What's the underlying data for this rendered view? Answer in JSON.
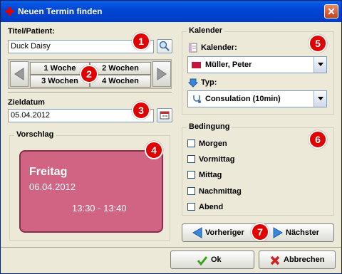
{
  "window": {
    "title": "Neuen Termin finden",
    "close_glyph": "✕"
  },
  "patient": {
    "label": "Titel/Patient:",
    "value": "Duck Daisy"
  },
  "nav": {
    "btn_1w_fwd": "1 Woche",
    "btn_2w_fwd": "2 Wochen",
    "btn_3w": "3 Wochen",
    "btn_4w": "4 Wochen"
  },
  "target": {
    "label": "Zieldatum",
    "value": "05.04.2012"
  },
  "proposal": {
    "label": "Vorschlag",
    "day": "Freitag",
    "date": "06.04.2012",
    "time": "13:30 - 13:40"
  },
  "calendar": {
    "group_label": "Kalender",
    "kalender_label": "Kalender:",
    "kalender_value": "Müller, Peter",
    "kalender_color": "#c8143c",
    "typ_label": "Typ:",
    "typ_value": "Consulation  (10min)"
  },
  "condition": {
    "label": "Bedingung",
    "options": [
      "Morgen",
      "Vormittag",
      "Mittag",
      "Nachmittag",
      "Abend"
    ]
  },
  "actions": {
    "prev": "Vorheriger",
    "next": "Nächster",
    "ok": "Ok",
    "cancel": "Abbrechen"
  },
  "badges": [
    "1",
    "2",
    "3",
    "4",
    "5",
    "6",
    "7"
  ]
}
